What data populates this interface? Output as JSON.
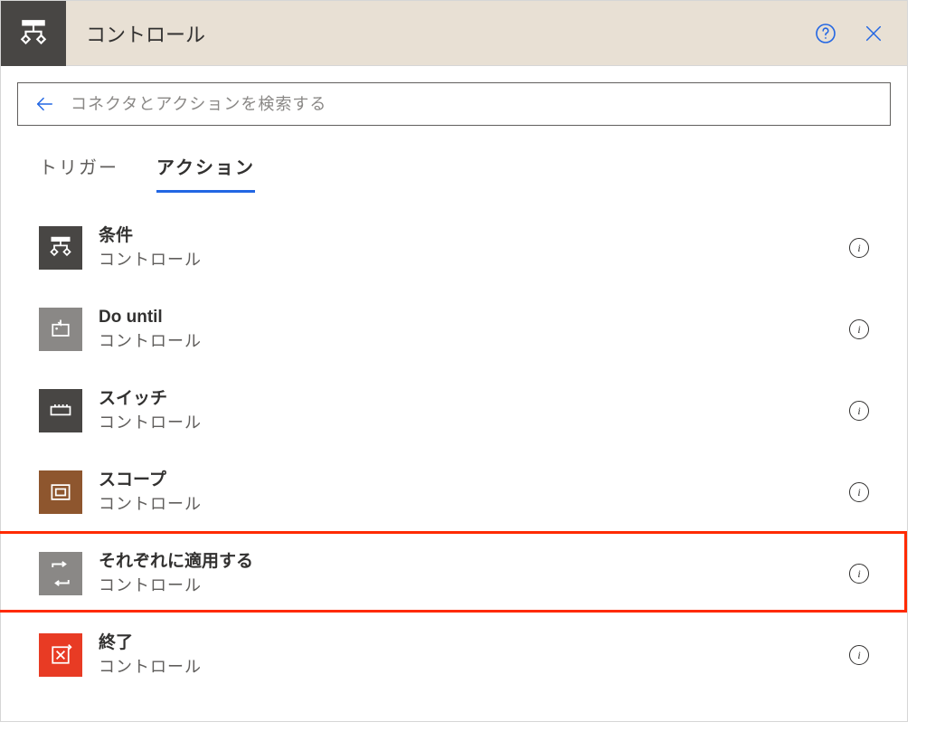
{
  "header": {
    "title": "コントロール"
  },
  "search": {
    "placeholder": "コネクタとアクションを検索する"
  },
  "tabs": {
    "triggers": "トリガー",
    "actions": "アクション"
  },
  "subLabel": "コントロール",
  "items": [
    {
      "title": "条件",
      "iconClass": "ic-dark",
      "iconName": "condition-icon",
      "highlighted": false
    },
    {
      "title": "Do until",
      "iconClass": "ic-gray",
      "iconName": "do-until-icon",
      "highlighted": false
    },
    {
      "title": "スイッチ",
      "iconClass": "ic-dark",
      "iconName": "switch-icon",
      "highlighted": false
    },
    {
      "title": "スコープ",
      "iconClass": "ic-brown",
      "iconName": "scope-icon",
      "highlighted": false
    },
    {
      "title": "それぞれに適用する",
      "iconClass": "ic-gray",
      "iconName": "apply-each-icon",
      "highlighted": true
    },
    {
      "title": "終了",
      "iconClass": "ic-red",
      "iconName": "terminate-icon",
      "highlighted": false
    }
  ],
  "infoGlyph": "i"
}
